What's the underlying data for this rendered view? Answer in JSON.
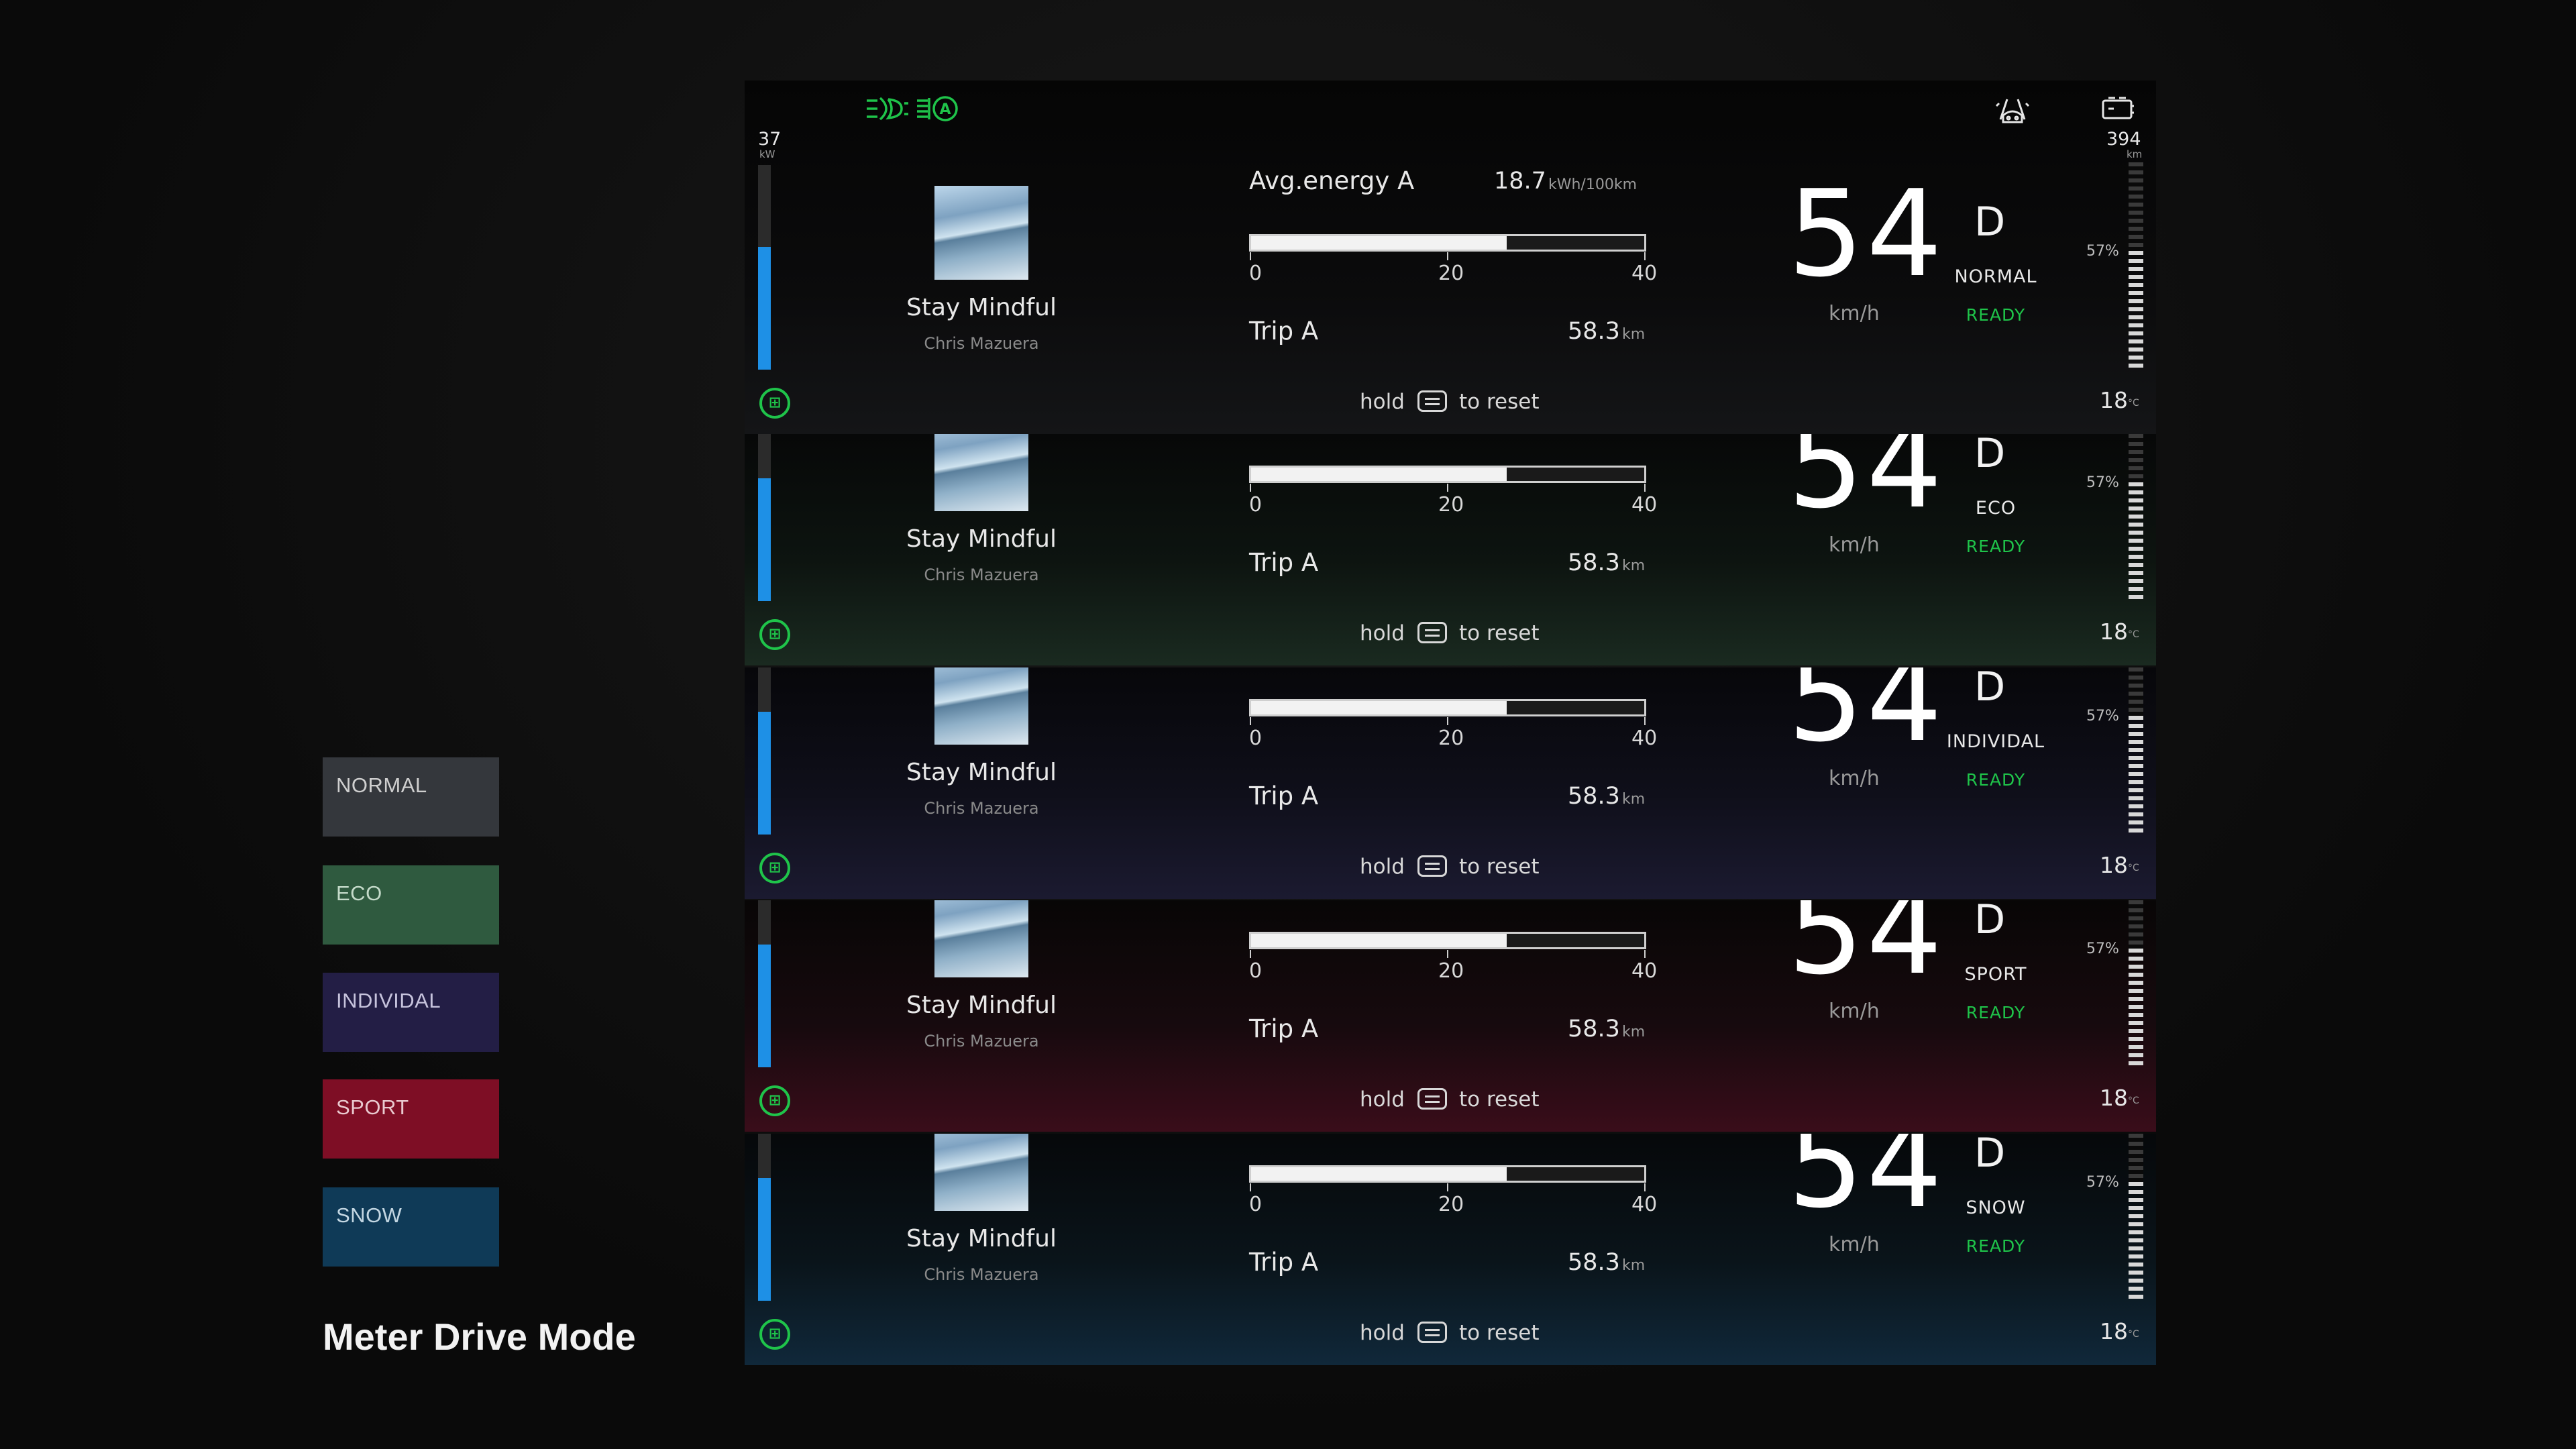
{
  "legend": [
    {
      "label": "NORMAL",
      "color": "#34373c"
    },
    {
      "label": "ECO",
      "color": "#2f5a3f"
    },
    {
      "label": "INDIVIDAL",
      "color": "#231e45"
    },
    {
      "label": "SPORT",
      "color": "#7e0e25"
    },
    {
      "label": "SNOW",
      "color": "#0f3a57"
    }
  ],
  "page_title": "Meter Drive Mode",
  "cluster": {
    "power_value": "37",
    "power_unit": "kW",
    "power_level": 0.6,
    "song": "Stay Mindful",
    "artist": "Chris Mazuera",
    "avg_energy_label": "Avg.energy A",
    "avg_energy_value": "18.7",
    "avg_energy_unit": "kWh/100km",
    "trip_bar_fraction": 0.65,
    "trip_scale": [
      "0",
      "20",
      "40"
    ],
    "trip_label": "Trip A",
    "trip_value": "58.3",
    "trip_unit": "km",
    "hold_text": "hold",
    "reset_text": "to reset",
    "speed": "54",
    "speed_unit": "km/h",
    "gear": "D",
    "ready": "READY",
    "range_value": "394",
    "range_unit": "km",
    "soc": "57%",
    "soc_level": 0.57,
    "temp_value": "18",
    "temp_unit": "°C",
    "eco_icon_glyph": "⊞",
    "accent_green": "#1fc44a",
    "accent_blue": "#1e90e6"
  },
  "panels": [
    {
      "mode": "NORMAL"
    },
    {
      "mode": "ECO"
    },
    {
      "mode": "INDIVIDAL"
    },
    {
      "mode": "SPORT"
    },
    {
      "mode": "SNOW"
    }
  ]
}
